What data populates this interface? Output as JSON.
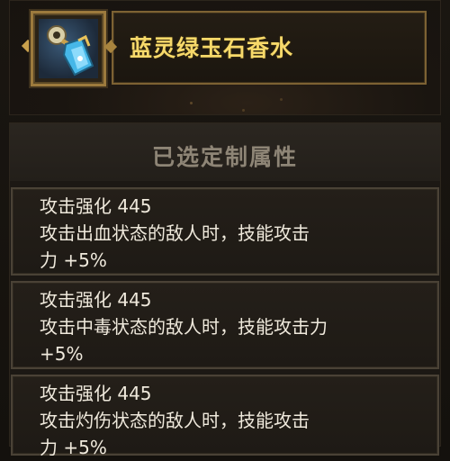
{
  "item": {
    "icon": "perfume-bottle-icon",
    "name": "蓝灵绿玉石香水"
  },
  "section": {
    "title": "已选定制属性"
  },
  "entries": [
    {
      "title": "攻击强化 445",
      "line1": "攻击出血状态的敌人时，技能攻击",
      "line2": "力 +5%"
    },
    {
      "title": "攻击强化 445",
      "line1": "攻击中毒状态的敌人时，技能攻击力",
      "line2": "+5%"
    },
    {
      "title": "攻击强化 445",
      "line1": "攻击灼伤状态的敌人时，技能攻击",
      "line2": "力 +5%"
    }
  ],
  "colors": {
    "title_gold": "#f7d96a",
    "frame_gold": "#9c7a3d",
    "text_white": "#efe9dc",
    "section_gray": "#8e8576"
  }
}
